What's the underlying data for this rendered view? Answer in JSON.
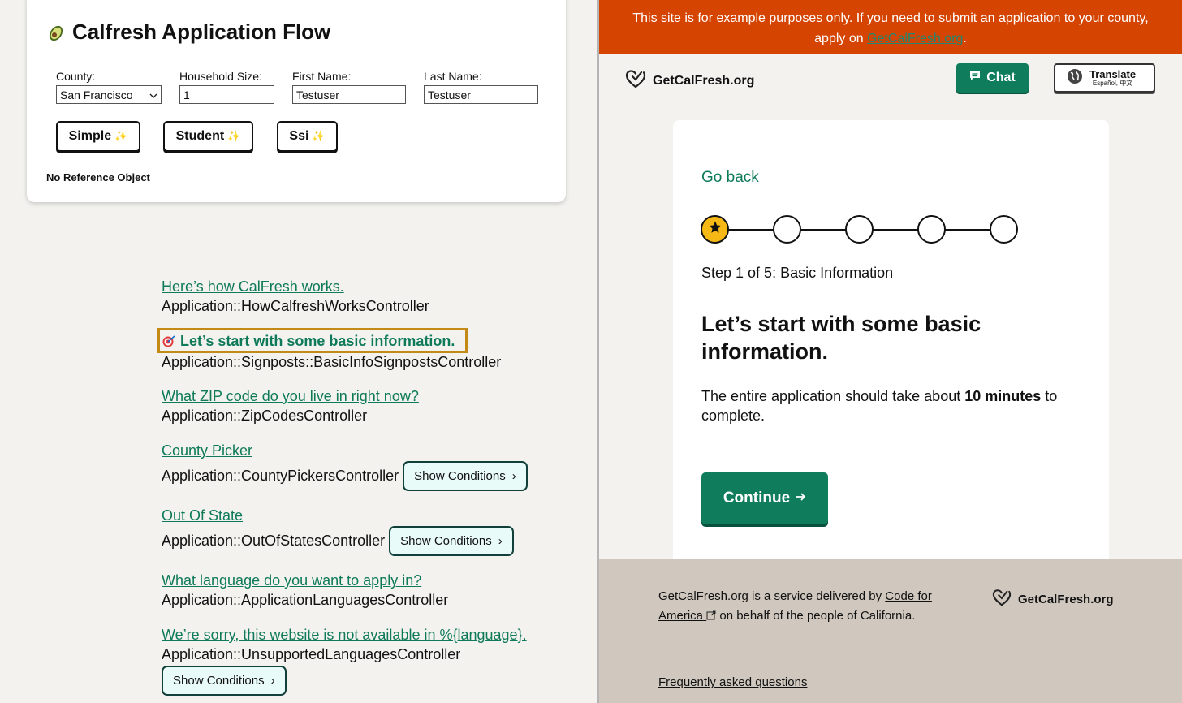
{
  "card": {
    "title": "Calfresh Application Flow",
    "icon": "avocado-icon",
    "fields": {
      "county_label": "County:",
      "county_value": "San Francisco",
      "household_label": "Household Size:",
      "household_value": "1",
      "first_label": "First Name:",
      "first_value": "Testuser",
      "last_label": "Last Name:",
      "last_value": "Testuser"
    },
    "presets": [
      "Simple",
      "Student",
      "Ssi"
    ],
    "no_reference": "No Reference Object"
  },
  "flow": [
    {
      "link": "Here’s how CalFresh works.",
      "controller": "Application::HowCalfreshWorksController"
    },
    {
      "link": "Let’s start with some basic information.",
      "controller": "Application::Signposts::BasicInfoSignpostsController",
      "current": true
    },
    {
      "link": "What ZIP code do you live in right now?",
      "controller": "Application::ZipCodesController"
    },
    {
      "link": "County Picker",
      "controller": "Application::CountyPickersController",
      "conditions": true
    },
    {
      "link": "Out Of State",
      "controller": "Application::OutOfStatesController",
      "conditions": true
    },
    {
      "link": "What language do you want to apply in?",
      "controller": "Application::ApplicationLanguagesController"
    },
    {
      "link": "We’re sorry, this website is not available in %{language}.",
      "controller": "Application::UnsupportedLanguagesController",
      "conditions": true
    }
  ],
  "show_conditions_label": "Show Conditions",
  "site": {
    "banner_text": "This site is for example purposes only. If you need to submit an application to your county, apply on",
    "banner_link": "GetCalFresh.org",
    "banner_end": ".",
    "brand": "GetCalFresh.org",
    "chat_label": "Chat",
    "translate_label": "Translate",
    "translate_sub": "Español, 中文",
    "go_back": "Go back",
    "step_label": "Step 1 of 5: Basic Information",
    "step_total": 5,
    "step_current": 1,
    "heading": "Let’s start with some basic information.",
    "intro_before": "The entire application should take about",
    "intro_bold": "10 minutes",
    "intro_after": "to complete.",
    "continue_label": "Continue",
    "footer_before": "GetCalFresh.org is a service delivered by",
    "footer_link": "Code for America",
    "footer_after": "on behalf of the people of California.",
    "faq": "Frequently asked questions"
  },
  "colors": {
    "brand_green": "#0f7d5b",
    "banner_orange": "#d54400",
    "step_active": "#f5b815",
    "highlight": "#c48a16"
  }
}
